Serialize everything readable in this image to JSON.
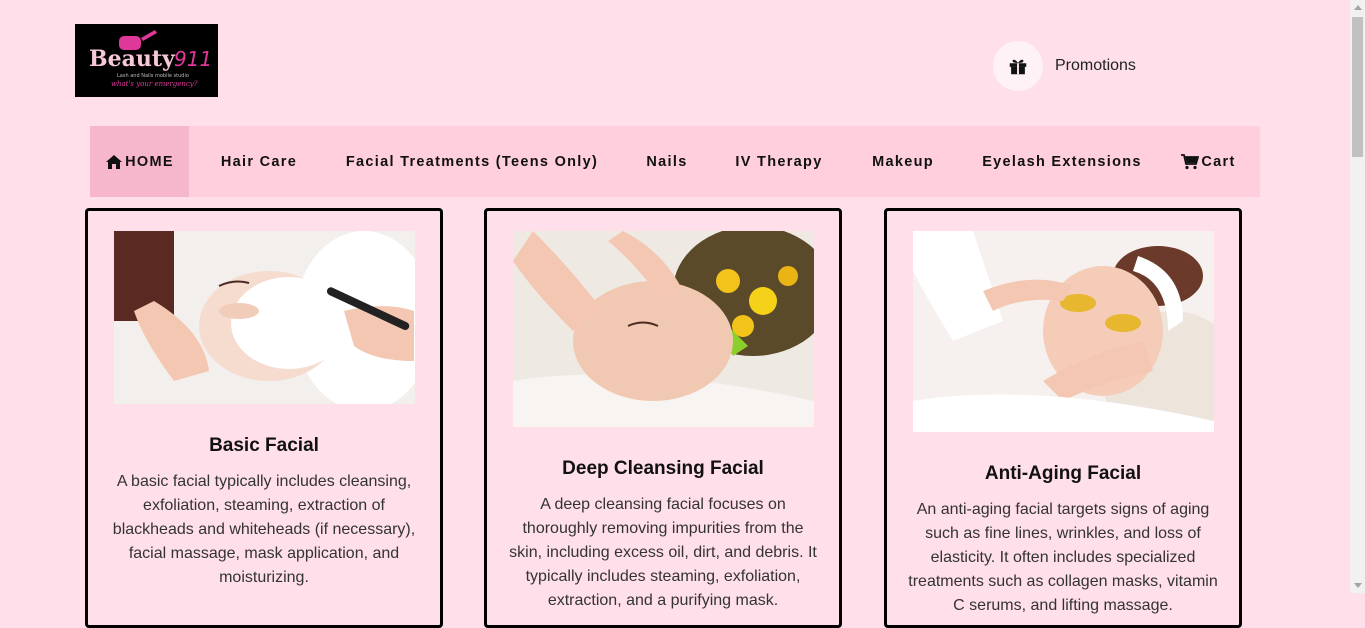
{
  "header": {
    "logo_text": "Beauty911",
    "logo_tagline": "what's your emergency?",
    "logo_subtext": "Lash and Nails mobile studio",
    "promotions_label": "Promotions",
    "promotions_icon": "gift-icon"
  },
  "nav": {
    "items": [
      {
        "label": "HOME",
        "icon": "home-icon",
        "active": true
      },
      {
        "label": "Hair Care"
      },
      {
        "label": "Facial Treatments (Teens Only)"
      },
      {
        "label": "Nails"
      },
      {
        "label": "IV Therapy"
      },
      {
        "label": "Makeup"
      },
      {
        "label": "Eyelash Extensions"
      },
      {
        "label": "Cart",
        "icon": "cart-icon"
      }
    ]
  },
  "cards": [
    {
      "title": "Basic Facial",
      "description": "A basic facial typically includes cleansing, exfoliation, steaming, extraction of blackheads and whiteheads (if necessary), facial massage, mask application, and moisturizing."
    },
    {
      "title": "Deep Cleansing Facial",
      "description": "A deep cleansing facial focuses on thoroughly removing impurities from the skin, including excess oil, dirt, and debris. It typically includes steaming, exfoliation, extraction, and a purifying mask."
    },
    {
      "title": "Anti-Aging Facial",
      "description": "An anti-aging facial targets signs of aging such as fine lines, wrinkles, and loss of elasticity. It often includes specialized treatments such as collagen masks, vitamin C serums, and lifting massage."
    }
  ],
  "colors": {
    "page_background": "#ffdfe9",
    "nav_background": "#ffcfdd",
    "nav_active": "#f6b6cb",
    "logo_pink": "#e0389a"
  }
}
